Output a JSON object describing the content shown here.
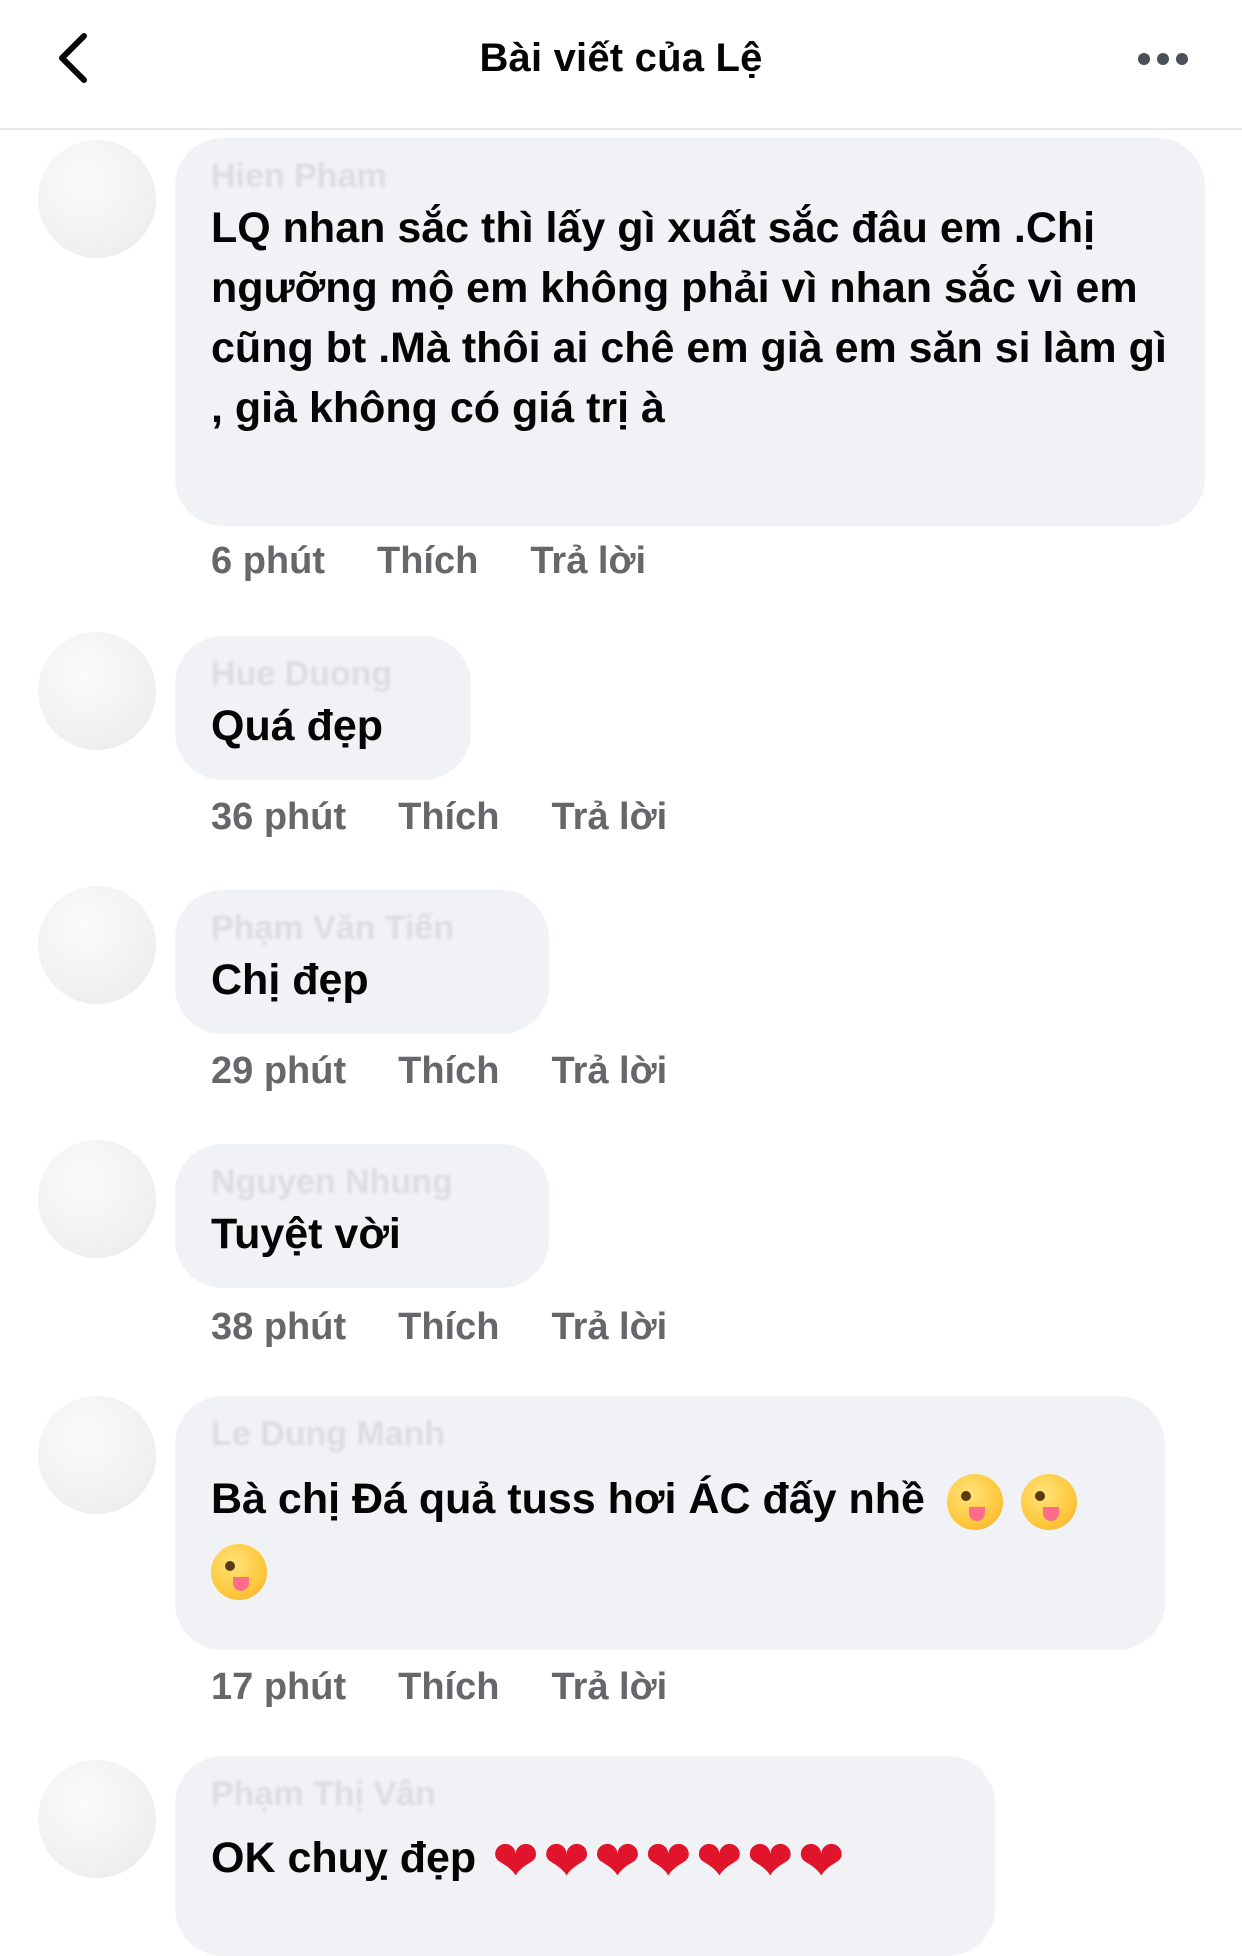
{
  "header": {
    "title": "Bài viết của Lệ"
  },
  "comments": [
    {
      "author": "Hien Pham",
      "text": "LQ nhan sắc thì lấy gì xuất sắc đâu em .Chị ngưỡng mộ em không phải vì nhan sắc vì em cũng bt .Mà thôi ai chê em già em săn si làm gì , già không có giá trị à",
      "time": "6 phút",
      "like": "Thích",
      "reply": "Trả lời"
    },
    {
      "author": "Hue Duong",
      "text": "Quá đẹp",
      "time": "36 phút",
      "like": "Thích",
      "reply": "Trả lời"
    },
    {
      "author": "Phạm Văn Tiến",
      "text": "Chị đẹp",
      "time": "29 phút",
      "like": "Thích",
      "reply": "Trả lời"
    },
    {
      "author": "Nguyen Nhung",
      "text": "Tuyệt vời",
      "time": "38 phút",
      "like": "Thích",
      "reply": "Trả lời"
    },
    {
      "author": "Le Dung Manh",
      "text": "Bà chị Đá quả tuss hơi ÁC đấy nhề",
      "time": "17 phút",
      "like": "Thích",
      "reply": "Trả lời",
      "emoji": [
        "winking-face-with-tongue",
        "winking-face-with-tongue",
        "winking-face-with-tongue"
      ]
    },
    {
      "author": "Phạm Thị Vân",
      "text": "OK chuỵ đẹp",
      "emoji": [
        "red-heart",
        "red-heart",
        "red-heart",
        "red-heart",
        "red-heart",
        "red-heart",
        "red-heart"
      ]
    }
  ]
}
